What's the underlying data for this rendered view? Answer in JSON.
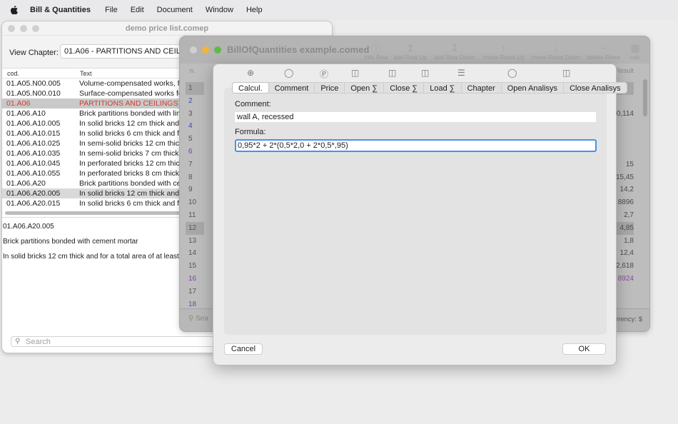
{
  "menubar": {
    "app_name": "Bill & Quantities",
    "items": [
      "File",
      "Edit",
      "Document",
      "Window",
      "Help"
    ]
  },
  "price_list_window": {
    "title": "demo price list.comep",
    "view_chapter_label": "View Chapter:",
    "view_chapter_value": "01.A06 - PARTITIONS AND CEILINGS",
    "columns": [
      "cod.",
      "Text"
    ],
    "rows": [
      {
        "code": "01.A05.N00.005",
        "text": "Volume-compensated works, fo"
      },
      {
        "code": "01.A05.N00.010",
        "text": "Surface-compensated works fo"
      },
      {
        "code": "01.A06",
        "text": "PARTITIONS AND CEILINGS"
      },
      {
        "code": "01.A06.A10",
        "text": "Brick partitions bonded with lim"
      },
      {
        "code": "01.A06.A10.005",
        "text": "In solid bricks 12 cm thick and f"
      },
      {
        "code": "01.A06.A10.015",
        "text": "In solid bricks 6 cm thick and fo"
      },
      {
        "code": "01.A06.A10.025",
        "text": "In semi-solid bricks 12 cm thick"
      },
      {
        "code": "01.A06.A10.035",
        "text": "In semi-solid bricks 7 cm thick"
      },
      {
        "code": "01.A06.A10.045",
        "text": "In perforated bricks 12 cm thick"
      },
      {
        "code": "01.A06.A10.055",
        "text": "In perforated bricks 8 cm thick"
      },
      {
        "code": "01.A06.A20",
        "text": "Brick partitions bonded with ce"
      },
      {
        "code": "01.A06.A20.005",
        "text": "In solid bricks 12 cm thick and f"
      },
      {
        "code": "01.A06.A20.015",
        "text": "In solid bricks 6 cm thick and fo"
      }
    ],
    "detail": {
      "code": "01.A06.A20.005",
      "line1": "Brick partitions bonded with cement mortar",
      "line2": "In solid bricks 12 cm thick and for a total area of at least 1 m²"
    },
    "search_placeholder": "Search"
  },
  "boq_window": {
    "title": "BillOfQuantities example.comed",
    "toolbar": [
      "Info Row",
      "add Row Up",
      "add Row Down",
      "move Rows Up",
      "move Rows Down",
      "delete Rows",
      "calc"
    ],
    "col_n": "n.",
    "col_result": "Result",
    "row_numbers": [
      "1",
      "2",
      "3",
      "4",
      "5",
      "6",
      "7",
      "8",
      "9",
      "10",
      "11",
      "12",
      "13",
      "14",
      "15",
      "16",
      "17",
      "18"
    ],
    "values": [
      "",
      "",
      "0,114",
      "",
      "",
      "",
      "15",
      "15,45",
      "14,2",
      "8896",
      "2,7",
      "4,85",
      "1,8",
      "12,4",
      "2,618",
      "8924",
      "",
      ""
    ],
    "search_placeholder": "Sea",
    "currency_label": "rrency: $"
  },
  "dialog": {
    "tabs": [
      "Calcul.",
      "Comment",
      "Price",
      "Open ∑",
      "Close ∑",
      "Load ∑",
      "Chapter",
      "Open Analisys",
      "Close Analisys"
    ],
    "comment_label": "Comment:",
    "comment_value": "wall A, recessed",
    "formula_label": "Formula:",
    "formula_value": "0,95*2 + 2*(0,5*2,0 + 2*0,5*,95)",
    "cancel_label": "Cancel",
    "ok_label": "OK",
    "accent_color": "#4a8ff0"
  }
}
